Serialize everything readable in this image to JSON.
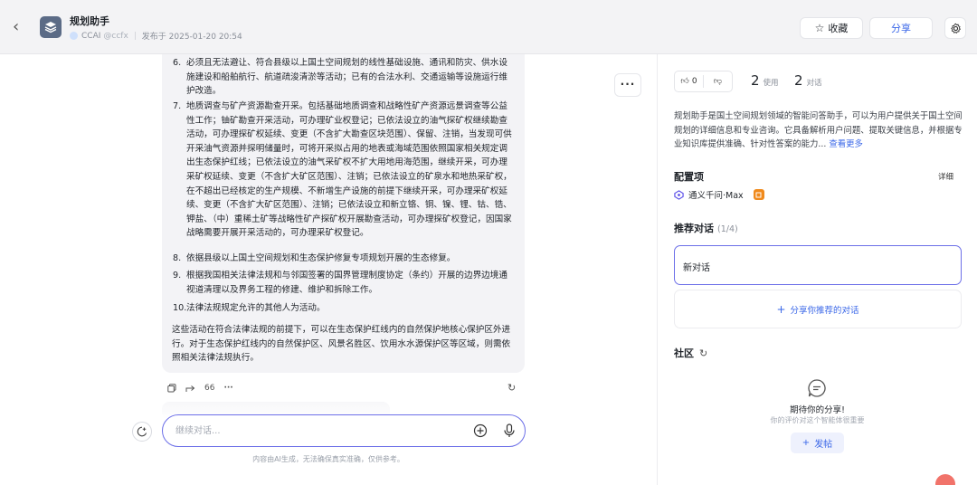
{
  "header": {
    "title": "规划助手",
    "author": "CCAI",
    "handle": "@ccfx",
    "published": "发布于 2025-01-20 20:54",
    "favorite_label": "收藏",
    "share_label": "分享"
  },
  "chat": {
    "items": [
      {
        "num": "6.",
        "text": "必须且无法避让、符合县级以上国土空间规划的线性基础设施、通讯和防灾、供水设施建设和船舶航行、航道疏浚清淤等活动；已有的合法水利、交通运输等设施运行维护改造。"
      },
      {
        "num": "7.",
        "text": "地质调查与矿产资源勘查开采。包括基础地质调查和战略性矿产资源远景调查等公益性工作；铀矿勘查开采活动，可办理矿业权登记；已依法设立的油气探矿权继续勘查活动，可办理探矿权延续、变更（不含扩大勘查区块范围）、保留、注销，当发现可供开采油气资源并探明储量时，可将开采拟占用的地表或海域范围依照国家相关规定调出生态保护红线；已依法设立的油气采矿权不扩大用地用海范围，继续开采，可办理采矿权延续、变更（不含扩大矿区范围）、注销；已依法设立的矿泉水和地热采矿权，在不超出已经核定的生产规模、不新增生产设施的前提下继续开采，可办理采矿权延续、变更（不含扩大矿区范围）、注销；已依法设立和新立铬、铜、镍、锂、钴、锆、钾盐、（中）重稀土矿等战略性矿产探矿权开展勘查活动，可办理探矿权登记，因国家战略需要开展开采活动的，可办理采矿权登记。"
      },
      {
        "num": "8.",
        "text": "依据县级以上国土空间规划和生态保护修复专项规划开展的生态修复。"
      },
      {
        "num": "9.",
        "text": "根据我国相关法律法规和与邻国签署的国界管理制度协定（条约）开展的边界边境通视道清理以及界务工程的修建、维护和拆除工作。"
      },
      {
        "num": "10.",
        "text": "法律法规规定允许的其他人为活动。"
      }
    ],
    "closing": "这些活动在符合法律法规的前提下，可以在生态保护红线内的自然保护地核心保护区外进行。对于生态保护红线内的自然保护区、风景名胜区、饮用水水源保护区等区域，则需依照相关法律法规执行。",
    "quote_count": "66",
    "input_placeholder": "继续对话...",
    "disclaimer": "内容由AI生成，无法确保真实准确，仅供参考。"
  },
  "sidebar": {
    "likes": "0",
    "uses_count": "2",
    "uses_label": "使用",
    "dialogs_count": "2",
    "dialogs_label": "对话",
    "description": "规划助手是国土空间规划领域的智能问答助手，可以为用户提供关于国土空间规划的详细信息和专业咨询。它具备解析用户问题、提取关键信息，并根据专业知识库提供准确、针对性答案的能力...",
    "see_more": "查看更多",
    "config_title": "配置项",
    "config_detail": "详细",
    "model_name": "通义千问·Max",
    "recommend_title": "推荐对话",
    "recommend_count": "(1/4)",
    "new_chat_label": "新对话",
    "share_recommend": "分享你推荐的对话",
    "community_title": "社区",
    "empty_title": "期待你的分享!",
    "empty_sub": "你的评价对这个智能体很重要",
    "post_label": "发帖"
  },
  "colors": {
    "accent": "#3a67e8",
    "input_border": "#6c6fe8",
    "bubble_bg": "#f3f3f6"
  }
}
